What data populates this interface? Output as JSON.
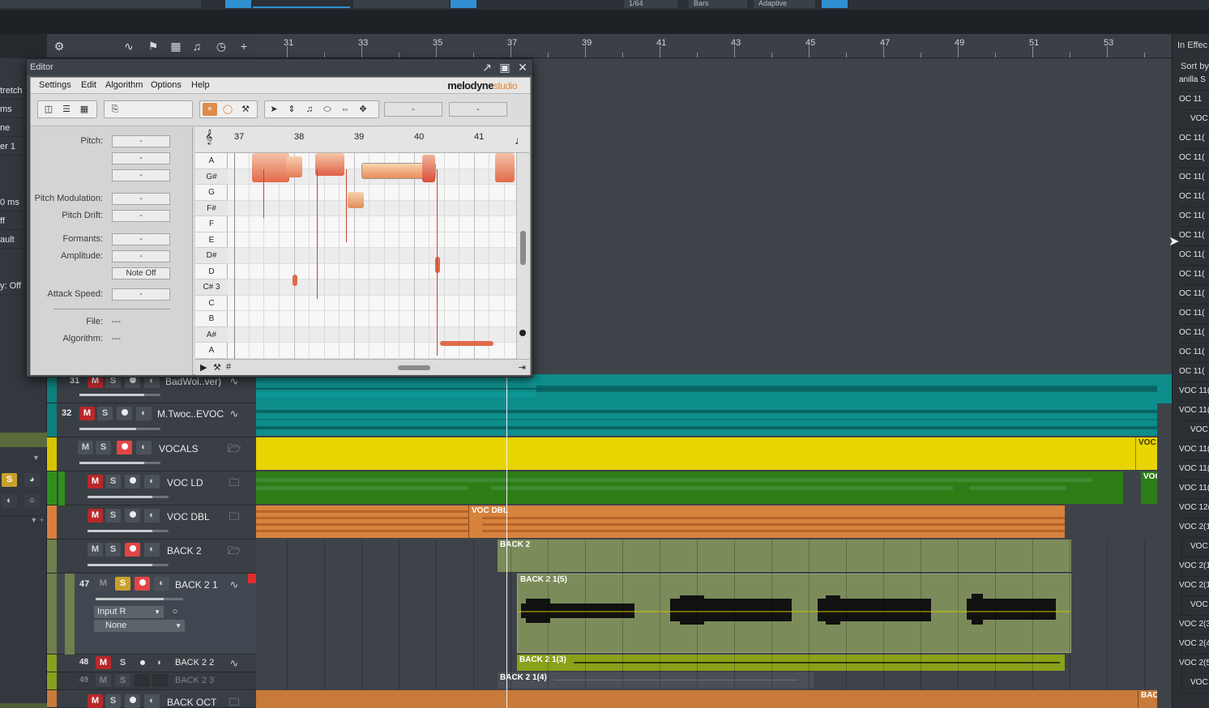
{
  "top_bar": {
    "segments": [
      "",
      "",
      "",
      "",
      "1/64",
      "Bars",
      "Adaptive",
      ""
    ]
  },
  "ruler": {
    "bars": [
      "31",
      "33",
      "35",
      "37",
      "39",
      "41",
      "43",
      "45",
      "47",
      "49",
      "51",
      "53"
    ]
  },
  "inspector": {
    "rows": [
      "tretch",
      "ms",
      "ne",
      "er 1",
      "0 ms",
      "ff",
      "ault",
      "y: Off"
    ],
    "solo_label": "S"
  },
  "browser": {
    "header": "In  Effec",
    "sort_label": "Sort by",
    "items": [
      "anilla S",
      "OC 11",
      "VOC",
      "OC 11(",
      "OC 11(",
      "OC 11(",
      "OC 11(",
      "OC 11(",
      "OC 11(",
      "OC 11(",
      "OC 11(",
      "OC 11(",
      "OC 11(",
      "OC 11(",
      "OC 11(",
      "OC 11(",
      "VOC 11(",
      "VOC 11(",
      "VOC",
      "VOC 11(",
      "VOC 11(",
      "VOC 11(",
      "VOC 12(",
      "VOC 2(1",
      "VOC",
      "VOC 2(1",
      "VOC 2(1",
      "VOC",
      "VOC 2(3",
      "VOC 2(4",
      "VOC 2(5",
      "VOC"
    ]
  },
  "editor": {
    "title": "Editor",
    "menus": [
      "Settings",
      "Edit",
      "Algorithm",
      "Options",
      "Help"
    ],
    "logo": "melodyne",
    "logo_suffix": "studio",
    "toolbar_fields": [
      "-",
      "-"
    ],
    "inspector": {
      "pitch_label": "Pitch:",
      "pitch_mod_label": "Pitch Modulation:",
      "pitch_drift_label": "Pitch Drift:",
      "formants_label": "Formants:",
      "amplitude_label": "Amplitude:",
      "note_off_label": "Note Off",
      "attack_label": "Attack Speed:",
      "file_label": "File:",
      "file_value": "---",
      "algorithm_label": "Algorithm:",
      "algorithm_value": "---",
      "dash": "-"
    },
    "bars": [
      "37",
      "38",
      "39",
      "40",
      "41"
    ],
    "keys": [
      "A",
      "G#",
      "G",
      "F#",
      "F",
      "E",
      "D#",
      "D",
      "C# 3",
      "C",
      "B",
      "A#",
      "A"
    ]
  },
  "tracks": [
    {
      "num": "31",
      "name": "BadWol..ver)",
      "color": "#00a9a6"
    },
    {
      "num": "32",
      "name": "M.Twoc..EVOC",
      "color": "#00a9a6"
    },
    {
      "num": "",
      "name": "VOCALS",
      "color": "#e8d400"
    },
    {
      "num": "",
      "name": "VOC LD",
      "color": "#2f8f1e"
    },
    {
      "num": "",
      "name": "VOC DBL",
      "color": "#d87f3d"
    },
    {
      "num": "",
      "name": "BACK 2",
      "color": "#7a8a50"
    },
    {
      "num": "47",
      "name": "BACK 2 1",
      "color": "#7a8a50",
      "input": "Input R",
      "output": "None"
    },
    {
      "num": "48",
      "name": "BACK 2 2",
      "color": "#8aa020"
    },
    {
      "num": "49",
      "name": "BACK 2 3",
      "color": "#8aa020"
    },
    {
      "num": "",
      "name": "BACK OCT",
      "color": "#c77a3a"
    }
  ],
  "buttons": {
    "mute": "M",
    "solo": "S"
  },
  "clips": {
    "vocals_edge": "VOC",
    "voc_ld_edge": "VOC",
    "voc_dbl": "VOC DBL",
    "back2": "BACK 2",
    "back2_1": "BACK 2 1(5)",
    "back2_2": "BACK 2 1(3)",
    "back2_3": "BACK 2 1(4)",
    "back_oct_edge": "BACI"
  },
  "colors": {
    "teal": "#0d8e8c",
    "yellow": "#e8d400",
    "green": "#2c7d16",
    "orange": "#d7833e",
    "olive": "#7b8c5a",
    "lime": "#8aa11a",
    "mute_red": "#b8282b",
    "melodyne_orange": "#e7883a"
  }
}
